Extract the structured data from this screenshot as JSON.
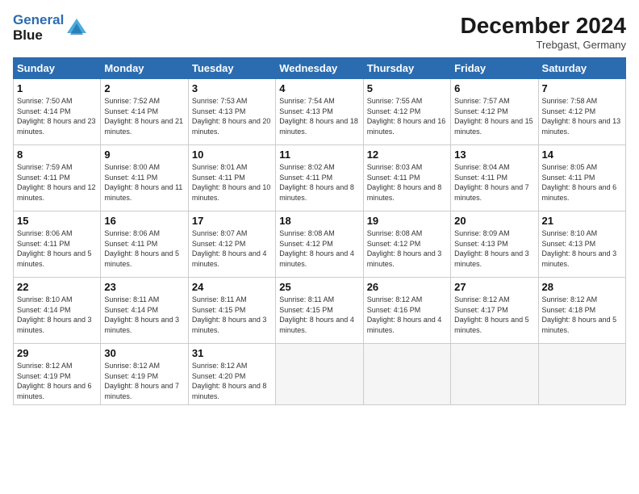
{
  "logo": {
    "line1": "General",
    "line2": "Blue"
  },
  "title": "December 2024",
  "location": "Trebgast, Germany",
  "days_of_week": [
    "Sunday",
    "Monday",
    "Tuesday",
    "Wednesday",
    "Thursday",
    "Friday",
    "Saturday"
  ],
  "weeks": [
    [
      {
        "day": "1",
        "sunrise": "7:50 AM",
        "sunset": "4:14 PM",
        "daylight": "8 hours and 23 minutes."
      },
      {
        "day": "2",
        "sunrise": "7:52 AM",
        "sunset": "4:14 PM",
        "daylight": "8 hours and 21 minutes."
      },
      {
        "day": "3",
        "sunrise": "7:53 AM",
        "sunset": "4:13 PM",
        "daylight": "8 hours and 20 minutes."
      },
      {
        "day": "4",
        "sunrise": "7:54 AM",
        "sunset": "4:13 PM",
        "daylight": "8 hours and 18 minutes."
      },
      {
        "day": "5",
        "sunrise": "7:55 AM",
        "sunset": "4:12 PM",
        "daylight": "8 hours and 16 minutes."
      },
      {
        "day": "6",
        "sunrise": "7:57 AM",
        "sunset": "4:12 PM",
        "daylight": "8 hours and 15 minutes."
      },
      {
        "day": "7",
        "sunrise": "7:58 AM",
        "sunset": "4:12 PM",
        "daylight": "8 hours and 13 minutes."
      }
    ],
    [
      {
        "day": "8",
        "sunrise": "7:59 AM",
        "sunset": "4:11 PM",
        "daylight": "8 hours and 12 minutes."
      },
      {
        "day": "9",
        "sunrise": "8:00 AM",
        "sunset": "4:11 PM",
        "daylight": "8 hours and 11 minutes."
      },
      {
        "day": "10",
        "sunrise": "8:01 AM",
        "sunset": "4:11 PM",
        "daylight": "8 hours and 10 minutes."
      },
      {
        "day": "11",
        "sunrise": "8:02 AM",
        "sunset": "4:11 PM",
        "daylight": "8 hours and 8 minutes."
      },
      {
        "day": "12",
        "sunrise": "8:03 AM",
        "sunset": "4:11 PM",
        "daylight": "8 hours and 8 minutes."
      },
      {
        "day": "13",
        "sunrise": "8:04 AM",
        "sunset": "4:11 PM",
        "daylight": "8 hours and 7 minutes."
      },
      {
        "day": "14",
        "sunrise": "8:05 AM",
        "sunset": "4:11 PM",
        "daylight": "8 hours and 6 minutes."
      }
    ],
    [
      {
        "day": "15",
        "sunrise": "8:06 AM",
        "sunset": "4:11 PM",
        "daylight": "8 hours and 5 minutes."
      },
      {
        "day": "16",
        "sunrise": "8:06 AM",
        "sunset": "4:11 PM",
        "daylight": "8 hours and 5 minutes."
      },
      {
        "day": "17",
        "sunrise": "8:07 AM",
        "sunset": "4:12 PM",
        "daylight": "8 hours and 4 minutes."
      },
      {
        "day": "18",
        "sunrise": "8:08 AM",
        "sunset": "4:12 PM",
        "daylight": "8 hours and 4 minutes."
      },
      {
        "day": "19",
        "sunrise": "8:08 AM",
        "sunset": "4:12 PM",
        "daylight": "8 hours and 3 minutes."
      },
      {
        "day": "20",
        "sunrise": "8:09 AM",
        "sunset": "4:13 PM",
        "daylight": "8 hours and 3 minutes."
      },
      {
        "day": "21",
        "sunrise": "8:10 AM",
        "sunset": "4:13 PM",
        "daylight": "8 hours and 3 minutes."
      }
    ],
    [
      {
        "day": "22",
        "sunrise": "8:10 AM",
        "sunset": "4:14 PM",
        "daylight": "8 hours and 3 minutes."
      },
      {
        "day": "23",
        "sunrise": "8:11 AM",
        "sunset": "4:14 PM",
        "daylight": "8 hours and 3 minutes."
      },
      {
        "day": "24",
        "sunrise": "8:11 AM",
        "sunset": "4:15 PM",
        "daylight": "8 hours and 3 minutes."
      },
      {
        "day": "25",
        "sunrise": "8:11 AM",
        "sunset": "4:15 PM",
        "daylight": "8 hours and 4 minutes."
      },
      {
        "day": "26",
        "sunrise": "8:12 AM",
        "sunset": "4:16 PM",
        "daylight": "8 hours and 4 minutes."
      },
      {
        "day": "27",
        "sunrise": "8:12 AM",
        "sunset": "4:17 PM",
        "daylight": "8 hours and 5 minutes."
      },
      {
        "day": "28",
        "sunrise": "8:12 AM",
        "sunset": "4:18 PM",
        "daylight": "8 hours and 5 minutes."
      }
    ],
    [
      {
        "day": "29",
        "sunrise": "8:12 AM",
        "sunset": "4:19 PM",
        "daylight": "8 hours and 6 minutes."
      },
      {
        "day": "30",
        "sunrise": "8:12 AM",
        "sunset": "4:19 PM",
        "daylight": "8 hours and 7 minutes."
      },
      {
        "day": "31",
        "sunrise": "8:12 AM",
        "sunset": "4:20 PM",
        "daylight": "8 hours and 8 minutes."
      },
      null,
      null,
      null,
      null
    ]
  ]
}
